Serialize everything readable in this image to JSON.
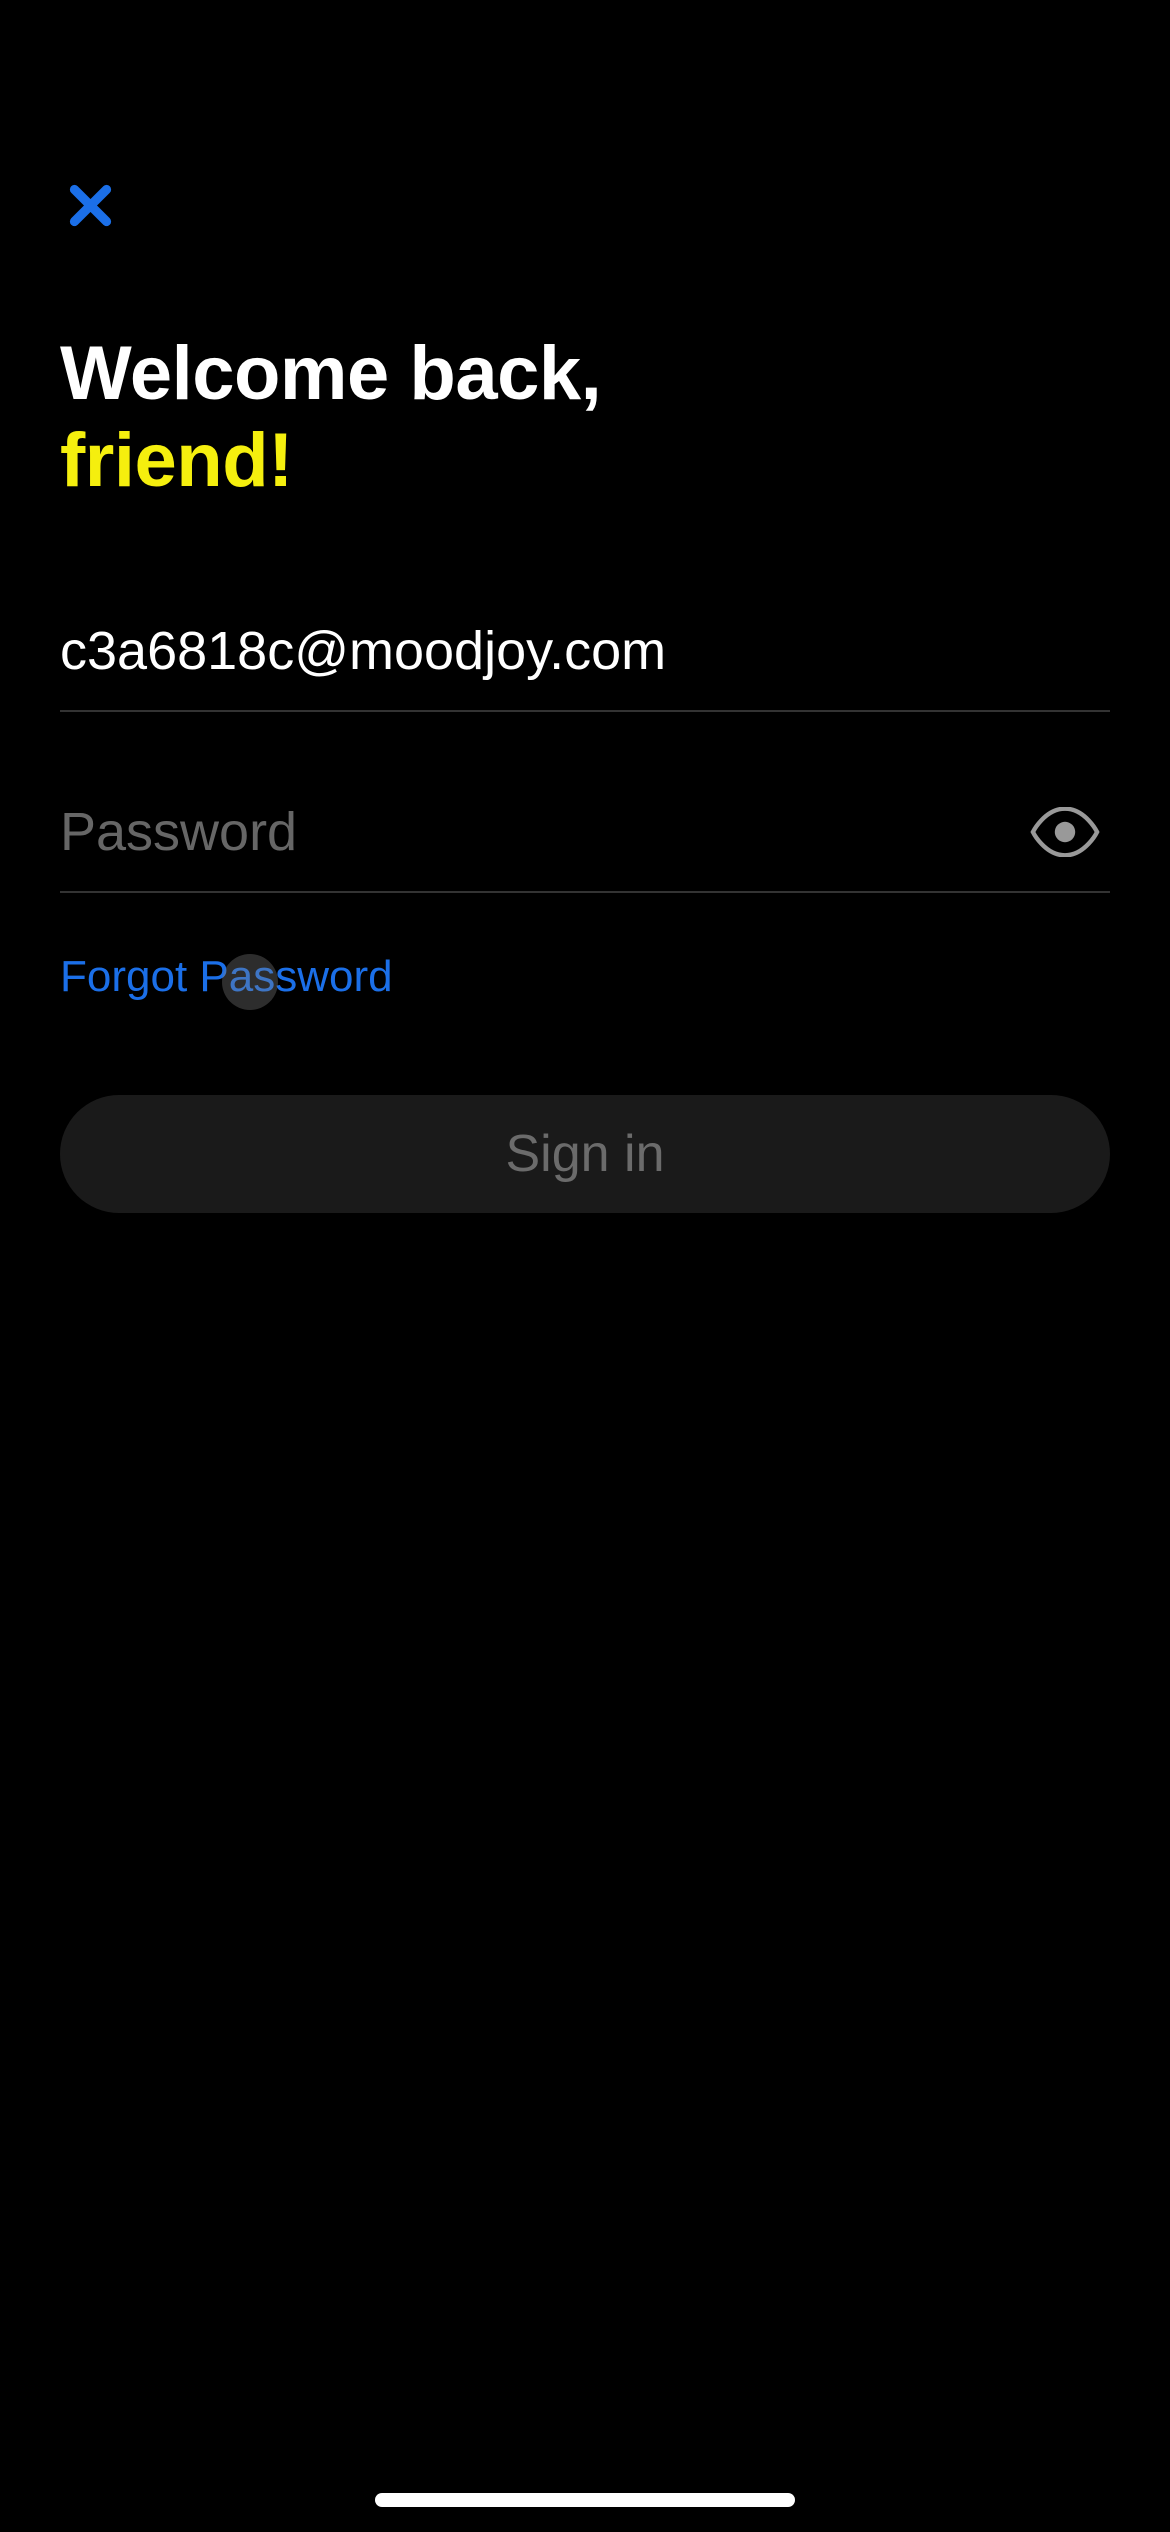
{
  "heading": {
    "line1": "Welcome back,",
    "line2": "friend!"
  },
  "email": {
    "value": "c3a6818c@moodjoy.com"
  },
  "password": {
    "placeholder": "Password"
  },
  "forgot_password_label": "Forgot Password",
  "signin_label": "Sign in"
}
